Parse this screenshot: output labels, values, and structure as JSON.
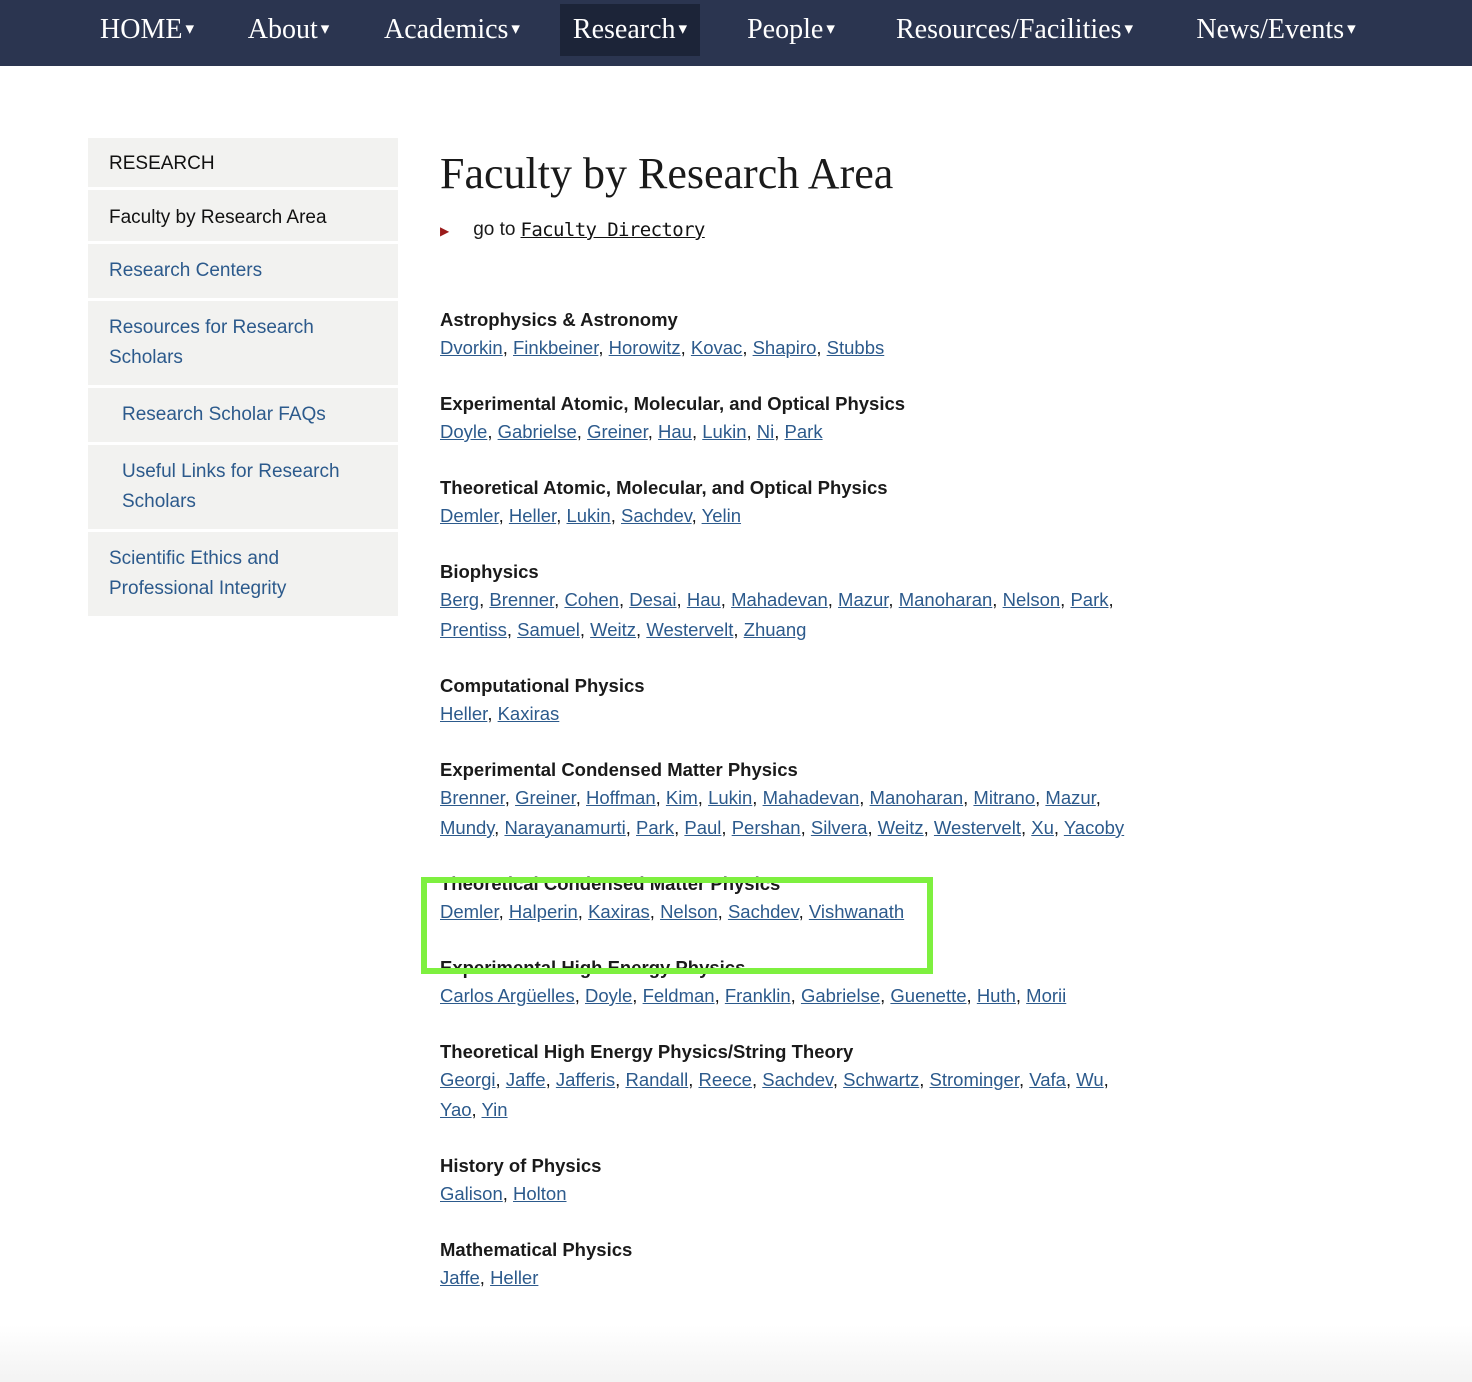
{
  "nav": {
    "items": [
      {
        "label": "HOME",
        "caret": "▾"
      },
      {
        "label": "About",
        "caret": "▾"
      },
      {
        "label": "Academics",
        "caret": "▾"
      },
      {
        "label": "Research",
        "caret": "▾"
      },
      {
        "label": "People",
        "caret": "▾"
      },
      {
        "label": "Resources/Facilities",
        "caret": "▾"
      },
      {
        "label": "News/Events",
        "caret": "▾"
      }
    ],
    "active": "Research"
  },
  "sidebar": {
    "header": "RESEARCH",
    "items": [
      {
        "label": "Faculty by Research Area"
      },
      {
        "label": "Research Centers"
      },
      {
        "label": "Resources for Research Scholars"
      },
      {
        "label": "Research Scholar FAQs"
      },
      {
        "label": "Useful Links for Research Scholars"
      },
      {
        "label": "Scientific Ethics and Professional Integrity"
      }
    ]
  },
  "main": {
    "title": "Faculty by Research Area",
    "goto_prefix": "go to",
    "goto_link": "Faculty Directory",
    "bullet": "▶",
    "areas": [
      {
        "title": "Astrophysics & Astronomy",
        "names": [
          "Dvorkin",
          "Finkbeiner",
          "Horowitz",
          "Kovac",
          "Shapiro",
          "Stubbs"
        ]
      },
      {
        "title": "Experimental Atomic, Molecular, and Optical Physics",
        "names": [
          "Doyle",
          "Gabrielse",
          "Greiner",
          "Hau",
          "Lukin",
          "Ni",
          "Park"
        ]
      },
      {
        "title": "Theoretical Atomic, Molecular, and Optical Physics",
        "names": [
          "Demler",
          "Heller",
          "Lukin",
          "Sachdev",
          "Yelin"
        ]
      },
      {
        "title": "Biophysics",
        "names": [
          "Berg",
          "Brenner",
          "Cohen",
          "Desai",
          "Hau",
          "Mahadevan",
          "Mazur",
          "Manoharan",
          "Nelson",
          "Park",
          "Prentiss",
          "Samuel",
          "Weitz",
          "Westervelt",
          "Zhuang"
        ]
      },
      {
        "title": "Computational Physics",
        "names": [
          "Heller",
          "Kaxiras"
        ]
      },
      {
        "title": "Experimental Condensed Matter Physics",
        "names": [
          "Brenner",
          "Greiner",
          "Hoffman",
          "Kim",
          "Lukin",
          "Mahadevan",
          "Manoharan",
          "Mitrano",
          "Mazur",
          "Mundy",
          "Narayanamurti",
          "Park",
          "Paul",
          "Pershan",
          "Silvera",
          "Weitz",
          "Westervelt",
          "Xu",
          "Yacoby"
        ]
      },
      {
        "title": "Theoretical Condensed Matter Physics",
        "names": [
          "Demler",
          "Halperin",
          "Kaxiras",
          "Nelson",
          "Sachdev",
          "Vishwanath"
        ]
      },
      {
        "title": "Experimental High Energy Physics",
        "names": [
          "Carlos Argüelles",
          "Doyle",
          "Feldman",
          "Franklin",
          "Gabrielse",
          "Guenette",
          "Huth",
          "Morii"
        ]
      },
      {
        "title": "Theoretical High Energy Physics/String Theory",
        "names": [
          "Georgi",
          "Jaffe",
          "Jafferis",
          "Randall",
          "Reece",
          "Sachdev",
          "Schwartz",
          "Strominger",
          "Vafa",
          "Wu",
          "Yao",
          "Yin"
        ]
      },
      {
        "title": "History of Physics",
        "names": [
          "Galison",
          "Holton"
        ]
      },
      {
        "title": "Mathematical Physics",
        "names": [
          "Jaffe",
          "Heller"
        ]
      }
    ]
  }
}
